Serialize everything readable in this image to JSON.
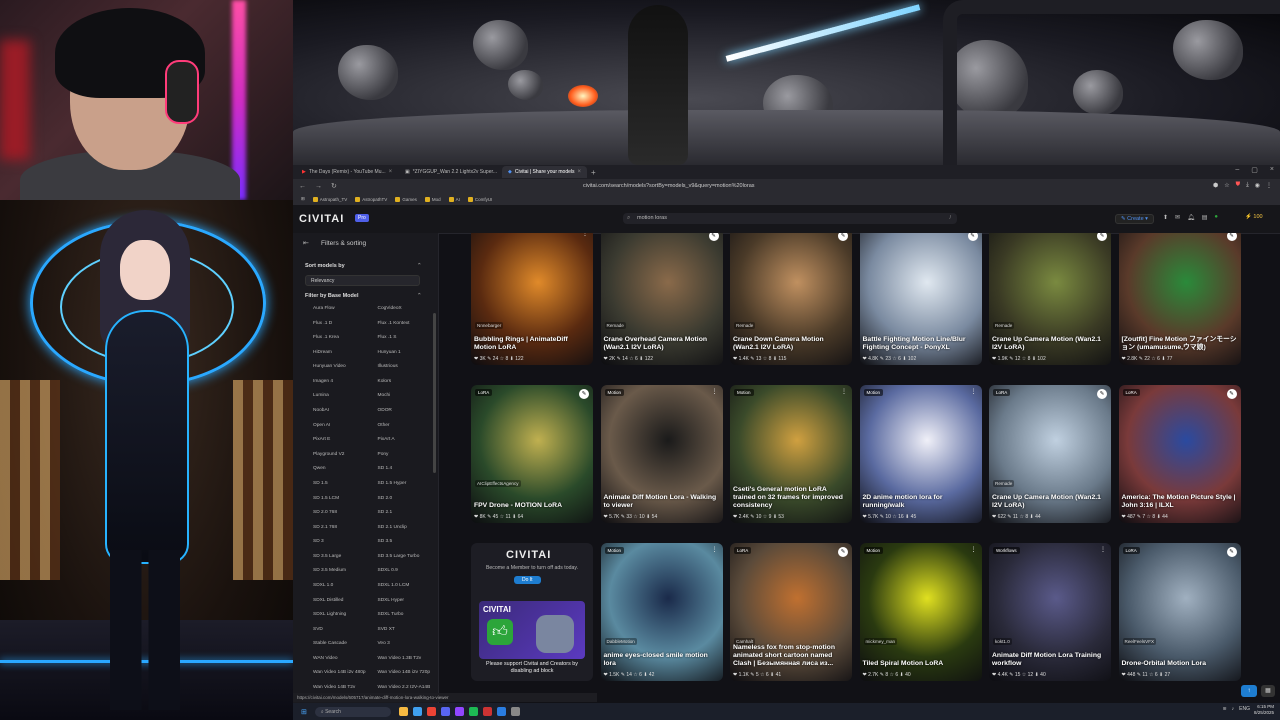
{
  "browser": {
    "tabs": [
      {
        "label": "The Days (Remix) - YouTube Mu...",
        "active": false
      },
      {
        "label": "*ZIYGGUP_Wan 2.2 Lightx2v Super...",
        "active": false
      },
      {
        "label": "Civitai | Share your models",
        "active": true
      }
    ],
    "url": "civitai.com/search/models?sortBy=models_v9&query=motion%20loras",
    "bookmarks": [
      "Astropath_TV",
      "AstropathTV",
      "Games",
      "Mod",
      "AI",
      "ComfyUI"
    ],
    "status_url": "https://civitai.com/models/605717/animate-diff-motion-lora-walking-to-viewer"
  },
  "civitai": {
    "logo": "CIVITAI",
    "pro_badge": "Pro",
    "search_value": "motion loras",
    "create_label": "Create",
    "buzz_count": "100"
  },
  "sidebar": {
    "title": "Filters & sorting",
    "sort_heading": "Sort models by",
    "sort_value": "Relevancy",
    "base_heading": "Filter by Base Model",
    "base_models": [
      "Aura Flow",
      "CogVideoX",
      "Flux .1 D",
      "Flux .1 Kontext",
      "Flux .1 Krea",
      "Flux .1 S",
      "HiDream",
      "Hunyuan 1",
      "Hunyuan Video",
      "Illustrious",
      "Imagen 4",
      "Kolors",
      "Lumina",
      "Mochi",
      "NoobAI",
      "ODOR",
      "Open AI",
      "Other",
      "PixArt E",
      "PixArt A",
      "Playground V2",
      "Pony",
      "Qwen",
      "SD 1.4",
      "SD 1.5",
      "SD 1.5 Hyper",
      "SD 1.5 LCM",
      "SD 2.0",
      "SD 2.0 768",
      "SD 2.1",
      "SD 2.1 768",
      "SD 2.1 Unclip",
      "SD 3",
      "SD 3.5",
      "SD 3.5 Large",
      "SD 3.5 Large Turbo",
      "SD 3.5 Medium",
      "SDXL 0.9",
      "SDXL 1.0",
      "SDXL 1.0 LCM",
      "SDXL Distilled",
      "SDXL Hyper",
      "SDXL Lightning",
      "SDXL Turbo",
      "SVD",
      "SVD XT",
      "Stable Cascade",
      "Veo 3",
      "WAN Video",
      "Wan Video 1.3B T2v",
      "Wan Video 14B i2v 480p",
      "Wan Video 14B i2v 720p",
      "Wan Video 14B T2v",
      "Wan Video 2.2 I2V-A14B"
    ]
  },
  "cards": [
    {
      "title": "Bubbling Rings | AnimateDiff Motion LoRA",
      "stats": "❤ 3K  ✎ 24  ☆ 8  ⬇ 122",
      "badge": "",
      "creator": "Nnnebarger",
      "bg": "#5a2a10",
      "accent": "#e08a2a",
      "edit": false
    },
    {
      "title": "Crane Overhead Camera Motion (Wan2.1 I2V LoRA)",
      "stats": "❤ 2K  ✎ 14  ☆ 6  ⬇ 122",
      "badge": "",
      "creator": "Remade",
      "bg": "#3a3a30",
      "accent": "#8a6a4a",
      "edit": true
    },
    {
      "title": "Crane Down Camera Motion (Wan2.1 I2V LoRA)",
      "stats": "❤ 1.4K  ✎ 13  ☆ 8  ⬇ 115",
      "badge": "",
      "creator": "Remade",
      "bg": "#4a3a28",
      "accent": "#c09060",
      "edit": true
    },
    {
      "title": "Battle Fighting Motion Line/Blur Fighting Concept - PonyXL",
      "stats": "❤ 4.8K  ✎ 23  ☆ 6  ⬇ 102",
      "badge": "",
      "creator": "",
      "bg": "#7a8aa0",
      "accent": "#e0e8f0",
      "edit": true
    },
    {
      "title": "Crane Up Camera Motion (Wan2.1 I2V LoRA)",
      "stats": "❤ 1.9K  ✎ 12  ☆ 8  ⬇ 102",
      "badge": "",
      "creator": "Remade",
      "bg": "#3a3a24",
      "accent": "#7a8a40",
      "edit": true
    },
    {
      "title": "[Zoutfit] Fine Motion ファインモーション (umamusume,ウマ娘)",
      "stats": "❤ 2.8K  ✎ 22  ☆ 6  ⬇ 77",
      "badge": "",
      "creator": "",
      "bg": "#5a3a2a",
      "accent": "#2a8a3a",
      "edit": true
    },
    {
      "title": "FPV Drone - MOTION LoRA",
      "stats": "❤ 8K  ✎ 45  ☆ 11  ⬇ 64",
      "badge": "LoRA",
      "creator": "AIClipEffectsAgency",
      "bg": "#2a4a2a",
      "accent": "#c0b050",
      "edit": true
    },
    {
      "title": "Animate Diff Motion Lora - Walking to viewer",
      "stats": "❤ 5.7K  ✎ 33  ☆ 10  ⬇ 54",
      "badge": "Motion",
      "creator": "",
      "bg": "#6a5a4a",
      "accent": "#1a1a1a",
      "edit": false
    },
    {
      "title": "Cseti's General motion LoRA trained on 32 frames for improved consistency",
      "stats": "❤ 2.4K  ✎ 10  ☆ 9  ⬇ 53",
      "badge": "Motion",
      "creator": "",
      "bg": "#3a4a2a",
      "accent": "#d0a040",
      "edit": false
    },
    {
      "title": "2D anime motion lora for running/walk",
      "stats": "❤ 5.7K  ✎ 10  ☆ 16  ⬇ 45",
      "badge": "Motion",
      "creator": "",
      "bg": "#5a6aa0",
      "accent": "#f0f0f8",
      "edit": false
    },
    {
      "title": "Crane Up Camera Motion (Wan2.1 I2V LoRA)",
      "stats": "❤ 622  ✎ 11  ☆ 8  ⬇ 44",
      "badge": "LoRA",
      "creator": "Remade",
      "bg": "#6a7a8a",
      "accent": "#c0d0e0",
      "edit": true
    },
    {
      "title": "America: The Motion Picture Style | John 3:16 | ILXL",
      "stats": "❤ 487  ✎ 7  ☆ 8  ⬇ 44",
      "badge": "LoRA",
      "creator": "",
      "bg": "#7a3a3a",
      "accent": "#2a4aa0",
      "edit": true
    },
    {
      "ad": true
    },
    {
      "title": "anime eyes-closed smile motion lora",
      "stats": "❤ 1.5K  ✎ 14  ☆ 6  ⬇ 42",
      "badge": "Motion",
      "creator": "DabbleMotion",
      "bg": "#5a8aa0",
      "accent": "#1a2a4a",
      "edit": false
    },
    {
      "title": "Nameless fox from stop-motion animated short cartoon named Clash | Безымянная лиса из...",
      "stats": "❤ 1.1K  ✎ 5  ☆ 6  ⬇ 41",
      "badge": "LoRA",
      "creator": "Camhalt",
      "bg": "#5a4a3a",
      "accent": "#c07030",
      "edit": true
    },
    {
      "title": "Tiled Spiral Motion LoRA",
      "stats": "❤ 2.7K  ✎ 8  ☆ 6  ⬇ 40",
      "badge": "Motion",
      "creator": "mickmey_man",
      "bg": "#2a3a10",
      "accent": "#e0e020",
      "edit": false
    },
    {
      "title": "Animate Diff Motion Lora Training workflow",
      "stats": "❤ 4.4K  ✎ 15  ☆ 12  ⬇ 40",
      "badge": "Workflows",
      "creator": "kokt1.0",
      "bg": "#2a2a3a",
      "accent": "#5a5a8a",
      "edit": false
    },
    {
      "title": "Drone-Orbital Motion Lora",
      "stats": "❤ 448  ✎ 11  ☆ 6  ⬇ 27",
      "badge": "LoRA",
      "creator": "ReelFeelsVFX",
      "bg": "#4a5a6a",
      "accent": "#a0b0c0",
      "edit": true
    }
  ],
  "ad": {
    "logo": "CIVITAI",
    "line": "Become a Member to turn off ads today.",
    "button": "Do It",
    "image_logo": "CIVITAI",
    "support_text": "Please support Civitai and Creators by disabling ad block"
  },
  "taskbar": {
    "search": "Search",
    "tray": "ENG",
    "time": "6:15 PM",
    "date": "8/25/2025"
  }
}
